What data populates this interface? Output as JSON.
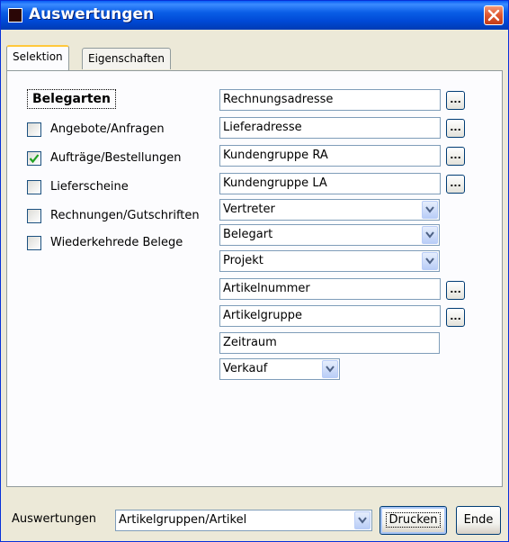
{
  "window": {
    "title": "Auswertungen"
  },
  "tabs": [
    {
      "label": "Selektion",
      "active": true
    },
    {
      "label": "Eigenschaften",
      "active": false
    }
  ],
  "belegarten": {
    "heading": "Belegarten",
    "items": [
      {
        "label": "Angebote/Anfragen",
        "checked": false
      },
      {
        "label": "Aufträge/Bestellungen",
        "checked": true
      },
      {
        "label": "Lieferscheine",
        "checked": false
      },
      {
        "label": "Rechnungen/Gutschriften",
        "checked": false
      },
      {
        "label": "Wiederkehrede Belege",
        "checked": false
      }
    ]
  },
  "fields": {
    "rechnungsadresse": "Rechnungsadresse",
    "lieferadresse": "Lieferadresse",
    "kundengruppe_ra": "Kundengruppe RA",
    "kundengruppe_la": "Kundengruppe LA",
    "vertreter": "Vertreter",
    "belegart": "Belegart",
    "projekt": "Projekt",
    "artikelnummer": "Artikelnummer",
    "artikelgruppe": "Artikelgruppe",
    "zeitraum": "Zeitraum",
    "verkauf": "Verkauf"
  },
  "browse_button_label": "...",
  "footer": {
    "auswertungen_label": "Auswertungen",
    "auswertungen_value": "Artikelgruppen/Artikel",
    "drucken_label": "Drucken",
    "ende_label": "Ende"
  },
  "colors": {
    "title_bar": "#0a5ee6",
    "close_button": "#e15a33",
    "tab_highlight": "#ffc83c"
  }
}
